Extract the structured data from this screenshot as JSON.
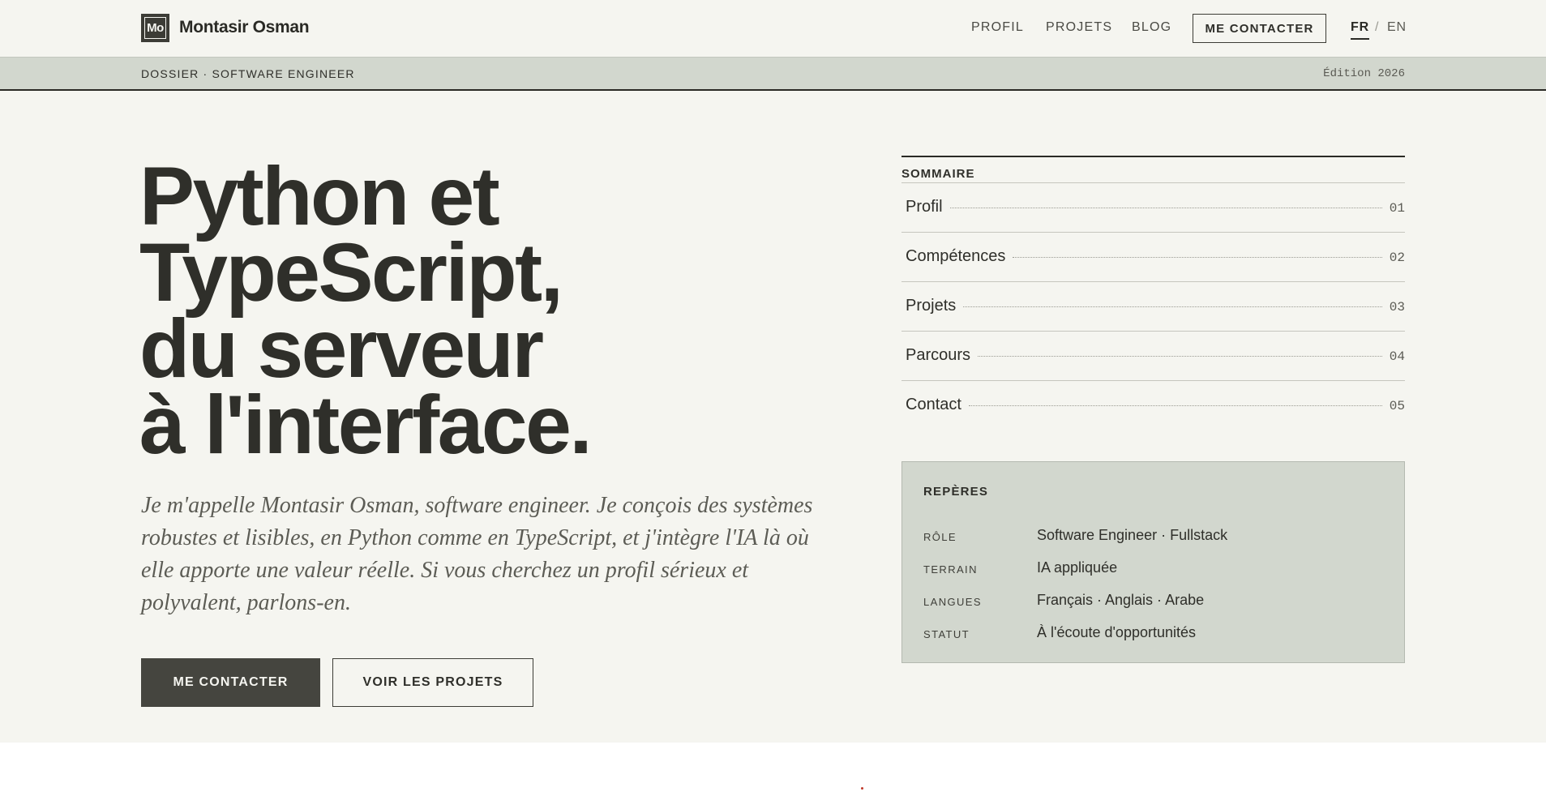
{
  "header": {
    "logo_text": "Mo",
    "brand": "Montasir Osman",
    "nav": [
      {
        "label": "PROFIL"
      },
      {
        "label": "PROJETS"
      },
      {
        "label": "BLOG"
      }
    ],
    "contact_button": "ME CONTACTER",
    "languages": {
      "active": "FR",
      "separator": "/",
      "other": "EN"
    }
  },
  "band": {
    "left": "DOSSIER · SOFTWARE ENGINEER",
    "right": "Édition 2026"
  },
  "hero": {
    "title_lines": [
      "Python et",
      "TypeScript,",
      "du serveur",
      "à l'interface."
    ],
    "lead": "Je m'appelle Montasir Osman, software engineer. Je conçois des systèmes robustes et lisibles, en Python comme en TypeScript, et j'intègre l'IA là où elle apporte une valeur réelle. Si vous cherchez un profil sérieux et polyvalent, parlons-en.",
    "primary_button": "ME CONTACTER",
    "secondary_button": "VOIR LES PROJETS"
  },
  "summary": {
    "title": "SOMMAIRE",
    "items": [
      {
        "label": "Profil",
        "number": "01"
      },
      {
        "label": "Compétences",
        "number": "02"
      },
      {
        "label": "Projets",
        "number": "03"
      },
      {
        "label": "Parcours",
        "number": "04"
      },
      {
        "label": "Contact",
        "number": "05"
      }
    ]
  },
  "reperes": {
    "title": "REPÈRES",
    "rows": [
      {
        "key": "RÔLE",
        "value": "Software Engineer · Fullstack"
      },
      {
        "key": "TERRAIN",
        "value": "IA appliquée"
      },
      {
        "key": "LANGUES",
        "value": "Français · Anglais · Arabe"
      },
      {
        "key": "STATUT",
        "value": "À l'écoute d'opportunités"
      }
    ]
  },
  "colors": {
    "background": "#f5f5f0",
    "band": "#d2d7ce",
    "ink": "#2f2f2a",
    "button_dark": "#45453f"
  }
}
